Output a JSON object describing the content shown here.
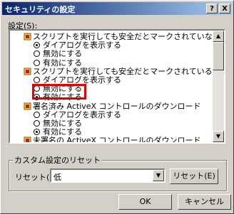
{
  "window": {
    "title": "セキュリティの設定",
    "help_btn": "?",
    "close_btn": "X"
  },
  "settings_label": "設定(S):",
  "items": [
    {
      "type": "category",
      "text": "スクリプトを実行しても安全だとマークされていない ActiveX コントロー..."
    },
    {
      "type": "option",
      "text": "ダイアログを表示する",
      "selected": true
    },
    {
      "type": "option",
      "text": "無効にする",
      "selected": false
    },
    {
      "type": "option",
      "text": "有効にする",
      "selected": false
    },
    {
      "type": "category",
      "text": "スクリプトを実行しても安全だとマークされている ActiveX コントロールの..."
    },
    {
      "type": "option",
      "text": "ダイアログを表示する",
      "selected": false
    },
    {
      "type": "option",
      "text": "無効にする",
      "selected": false
    },
    {
      "type": "option",
      "text": "有効にする",
      "selected": true
    },
    {
      "type": "category",
      "text": "署名済み ActiveX コントロールのダウンロード"
    },
    {
      "type": "option",
      "text": "ダイアログを表示する",
      "selected": false
    },
    {
      "type": "option",
      "text": "無効にする",
      "selected": false
    },
    {
      "type": "option",
      "text": "有効にする",
      "selected": true
    },
    {
      "type": "category",
      "text": "未署名の ActiveX コントロールのダウンロード"
    }
  ],
  "reset_group": {
    "title": "カスタム設定のリセット",
    "reset_to_label": "リセット(R):",
    "reset_value": "低",
    "reset_button": "リセット(E)"
  },
  "buttons": {
    "ok": "OK",
    "cancel": "キャンセル"
  },
  "colors": {
    "highlight": "#e00000",
    "titlebar": "#0a246a"
  }
}
